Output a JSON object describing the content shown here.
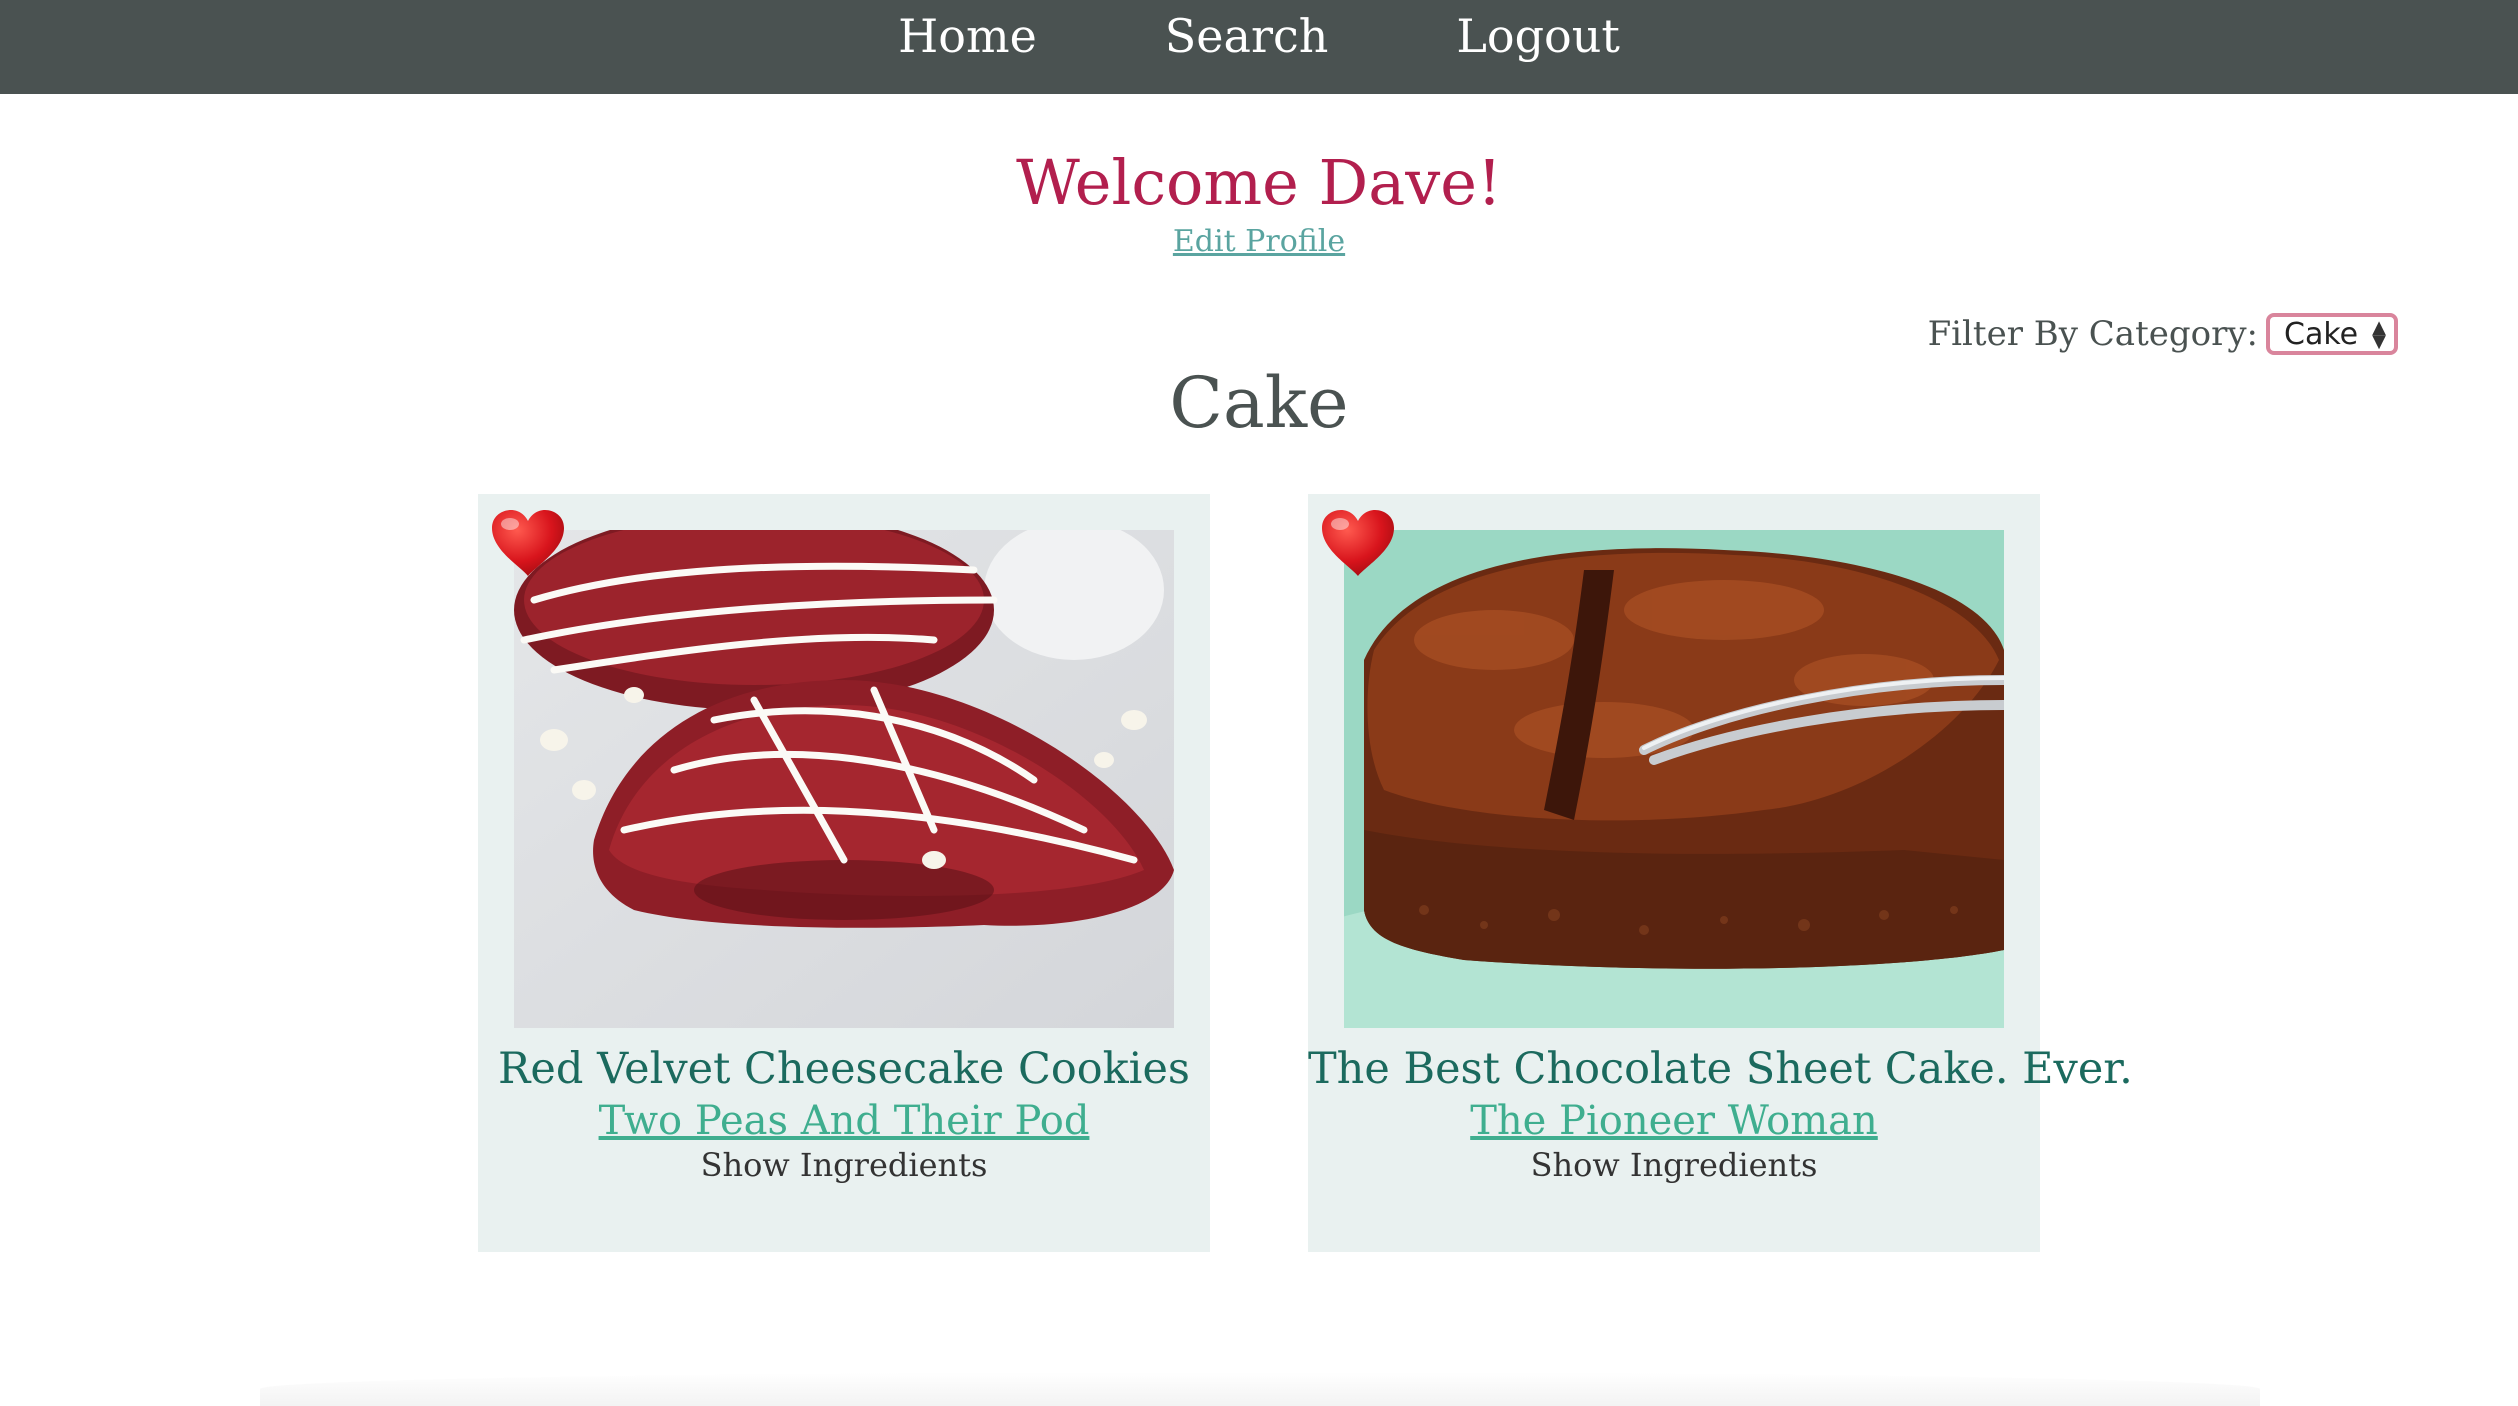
{
  "nav": {
    "items": [
      {
        "label": "Home"
      },
      {
        "label": "Search"
      },
      {
        "label": "Logout"
      }
    ]
  },
  "welcome": {
    "title": "Welcome Dave!",
    "edit_profile_label": "Edit Profile"
  },
  "filter": {
    "label": "Filter By Category:",
    "selected": "Cake"
  },
  "category": {
    "heading": "Cake"
  },
  "recipes": [
    {
      "title": "Red Velvet Cheesecake Cookies",
      "source": "Two Peas And Their Pod",
      "toggle_label": "Show Ingredients",
      "favorite_icon": "heart-icon"
    },
    {
      "title": "The Best Chocolate Sheet Cake. Ever.",
      "source": "The Pioneer Woman",
      "toggle_label": "Show Ingredients",
      "favorite_icon": "heart-icon"
    }
  ],
  "colors": {
    "nav_bg": "#4a5251",
    "welcome": "#b21f4e",
    "link": "#5aa4a0",
    "card_bg": "#e9f1f0",
    "card_title": "#1b6a5e",
    "source_link": "#3fae8f",
    "heart": "#d8141c"
  }
}
